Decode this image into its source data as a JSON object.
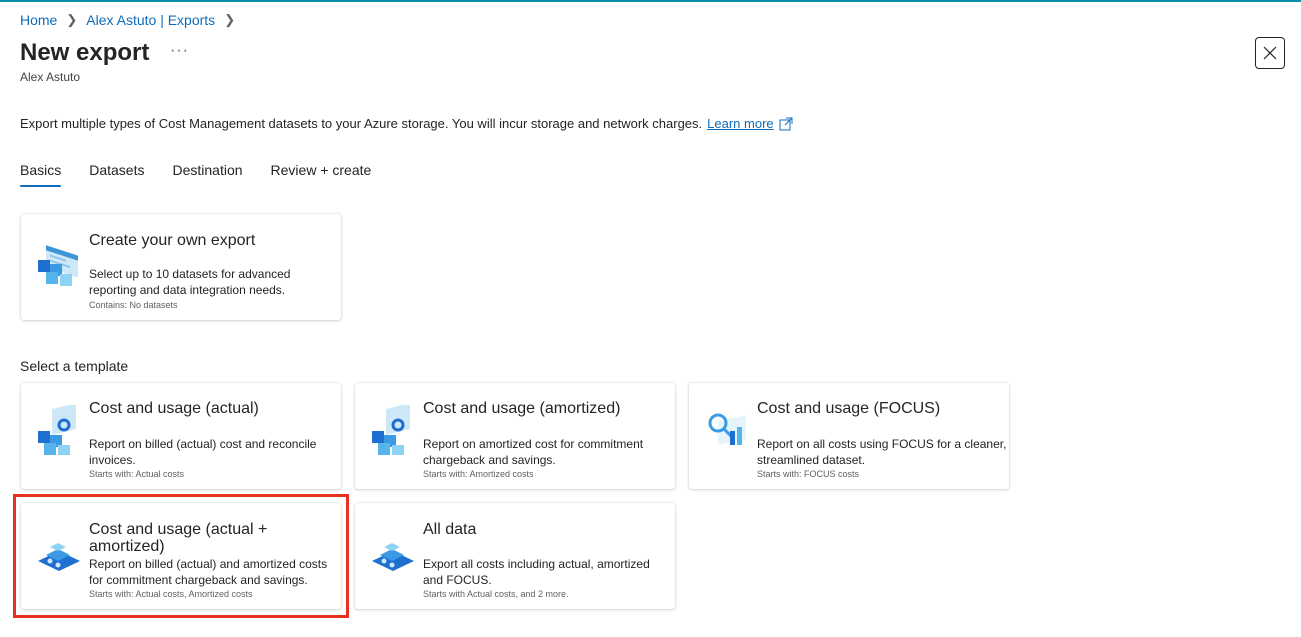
{
  "breadcrumb": {
    "home": "Home",
    "exports": "Alex Astuto | Exports"
  },
  "header": {
    "title": "New export",
    "more": "···",
    "subtitle": "Alex Astuto"
  },
  "description": {
    "text": "Export multiple types of Cost Management datasets to your Azure storage. You will incur storage and network charges.",
    "link": "Learn more"
  },
  "tabs": [
    "Basics",
    "Datasets",
    "Destination",
    "Review + create"
  ],
  "custom_card": {
    "title": "Create your own export",
    "desc": "Select up to 10 datasets for advanced reporting and data integration needs.",
    "meta": "Contains: No datasets"
  },
  "template_section": {
    "label": "Select a template"
  },
  "templates": [
    {
      "title": "Cost and usage (actual)",
      "desc": "Report on billed (actual) cost and reconcile invoices.",
      "meta": "Starts with: Actual costs"
    },
    {
      "title": "Cost and usage (amortized)",
      "desc": "Report on amortized cost for commitment chargeback and savings.",
      "meta": "Starts with: Amortized costs"
    },
    {
      "title": "Cost and usage (FOCUS)",
      "desc": "Report on all costs using FOCUS for a cleaner, streamlined dataset.",
      "meta": "Starts with: FOCUS costs"
    },
    {
      "title": "Cost and usage (actual + amortized)",
      "desc": "Report on billed (actual) and amortized costs for commitment chargeback and savings.",
      "meta": "Starts with: Actual costs, Amortized costs"
    },
    {
      "title": "All data",
      "desc": "Export all costs including actual, amortized and FOCUS.",
      "meta": "Starts with Actual costs, and 2 more."
    }
  ],
  "colors": {
    "accent": "#0f6cbd",
    "highlight": "#e8321f",
    "topline": "#0b8ea8"
  }
}
